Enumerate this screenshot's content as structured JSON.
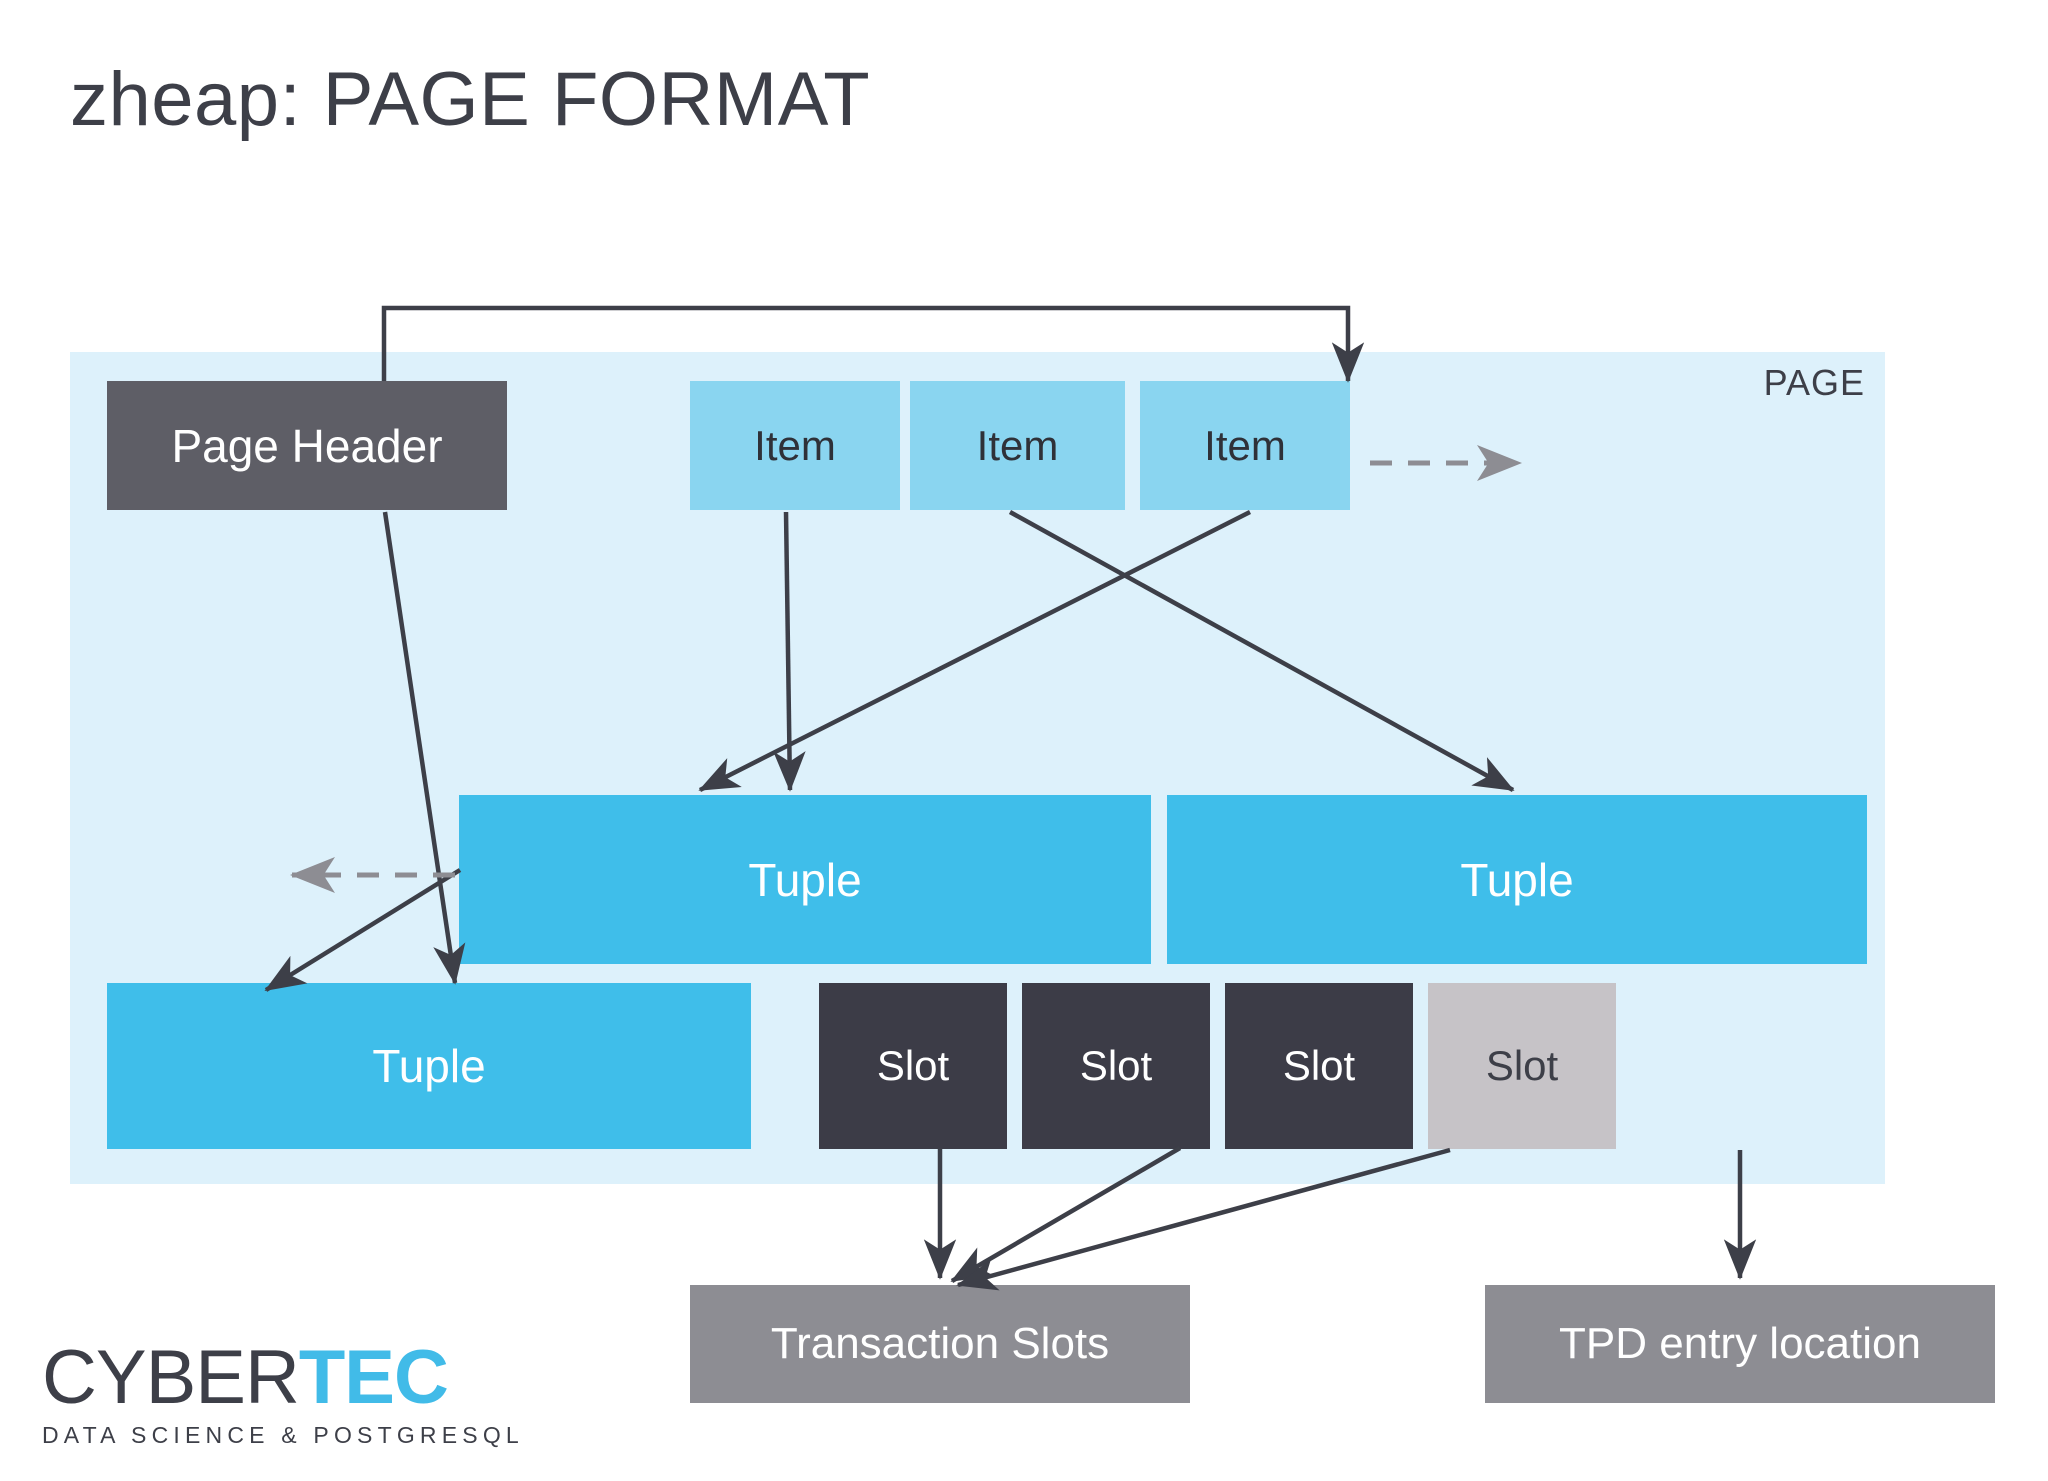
{
  "title": {
    "prefix": "zheap: ",
    "main": "PAGE FORMAT",
    "full": "zheap: PAGE FORMAT"
  },
  "page": {
    "label": "PAGE",
    "background_color": "#ddf1fb"
  },
  "blocks": {
    "page_header": {
      "label": "Page Header",
      "color": "#5e5e66",
      "text_color": "#ffffff"
    },
    "items": [
      {
        "label": "Item",
        "color": "#8ad5f0",
        "text_color": "#2f3138"
      },
      {
        "label": "Item",
        "color": "#8ad5f0",
        "text_color": "#2f3138"
      },
      {
        "label": "Item",
        "color": "#8ad5f0",
        "text_color": "#2f3138"
      }
    ],
    "tuples": [
      {
        "label": "Tuple",
        "color": "#3fbeea",
        "text_color": "#ffffff"
      },
      {
        "label": "Tuple",
        "color": "#3fbeea",
        "text_color": "#ffffff"
      },
      {
        "label": "Tuple",
        "color": "#3fbeea",
        "text_color": "#ffffff"
      }
    ],
    "slots": [
      {
        "label": "Slot",
        "color": "#3c3c47",
        "text_color": "#ffffff",
        "state": "used"
      },
      {
        "label": "Slot",
        "color": "#3c3c47",
        "text_color": "#ffffff",
        "state": "used"
      },
      {
        "label": "Slot",
        "color": "#3c3c47",
        "text_color": "#ffffff",
        "state": "used"
      },
      {
        "label": "Slot",
        "color": "#c6c3c7",
        "text_color": "#3d3f48",
        "state": "empty"
      }
    ],
    "captions": [
      {
        "label": "Transaction Slots",
        "color": "#8d8d93",
        "text_color": "#ffffff"
      },
      {
        "label": "TPD entry location",
        "color": "#8d8d93",
        "text_color": "#ffffff"
      }
    ]
  },
  "arrows": {
    "stroke_color": "#3d3f48",
    "dashed_color": "#8d8d93",
    "descriptions": [
      "page-header-to-last-item",
      "page-header-to-tuple-bottom-left",
      "item-1-to-tuple-1",
      "item-2-to-tuple-2",
      "item-3-to-tuple-1",
      "tuple-1-to-tuple-bottom-left",
      "items-growth-dashed-right",
      "tuples-growth-dashed-left",
      "slot-1-to-transaction-slots",
      "slot-2-to-transaction-slots",
      "slot-3-to-transaction-slots",
      "slot-4-to-tpd-entry-location"
    ]
  },
  "logo": {
    "word_primary": "CYBER",
    "word_accent": "TEC",
    "tagline": "DATA SCIENCE & POSTGRESQL",
    "primary_color": "#3d3f48",
    "accent_color": "#41bbe8"
  }
}
